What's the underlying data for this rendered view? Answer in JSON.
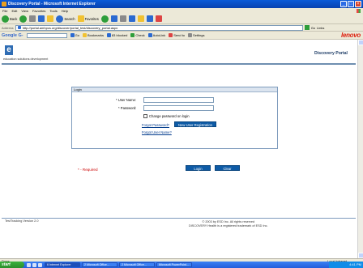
{
  "window": {
    "title": "Discovery Portal - Microsoft Internet Explorer"
  },
  "menu": [
    "File",
    "Edit",
    "View",
    "Favorites",
    "Tools",
    "Help"
  ],
  "toolbar": {
    "back": "Back",
    "search": "Search",
    "favorites": "Favorites"
  },
  "address": {
    "label": "Address",
    "url": "http://portal.amhpcs.org/discover/portal_test/discovery_portal.aspx",
    "go": "Go",
    "links": "Links"
  },
  "google_bar": {
    "logo": "Google G-",
    "go": "Go",
    "bookmarks": "Bookmarks",
    "blocked": "83 blocked",
    "check": "Check",
    "autolink": "AutoLink",
    "sendto": "Send to",
    "settings": "Settings",
    "brand": "lenovo"
  },
  "header": {
    "logo_letter": "e",
    "logo_text": "education solutions development",
    "portal_title": "Discovery Portal"
  },
  "login": {
    "section": "Login",
    "username_label": "* User Name:",
    "password_label": "* Password:",
    "change_password": "Change password on login",
    "forgot_password": "Forgot Password?",
    "forgot_username": "Forgot User Name?",
    "new_user_button": "New User Registration"
  },
  "form": {
    "required_note": "* - Required",
    "login_button": "Login",
    "clear_button": "Clear"
  },
  "footer": {
    "version": "TestTracking Version 2.0",
    "copyright_line1": "© 2003 by ESD Inc. All rights reserved",
    "copyright_line2": "DISCOVERY Health is a registered trademark of ESD Inc."
  },
  "status": {
    "text": "Done",
    "zone": "Local intranet"
  },
  "taskbar": {
    "start": "start",
    "tasks": [
      "6 Internet Explorer",
      "2 Microsoft Office...",
      "2 Microsoft Office...",
      "Microsoft PowerPoint..."
    ],
    "clock": "4:41 PM"
  }
}
